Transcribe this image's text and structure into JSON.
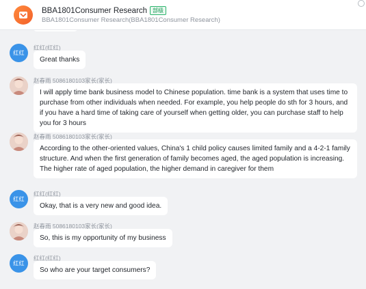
{
  "header": {
    "title": "BBA1801Consumer Research",
    "badge": "部级",
    "subtitle": "BBA1801Consumer Research(BBA1801Consumer Research)"
  },
  "colors": {
    "avatar_blue": "#3a93e8",
    "group_orange": "#f3612a",
    "badge_green": "#29b36b"
  },
  "messages": [
    {
      "sender": "红红(红红)",
      "avatar_text": "红红",
      "text": "Great thanks"
    },
    {
      "sender": "赵春雨 5086180103家长(家长)",
      "text": "I will apply time bank business model to Chinese population. time bank is a system that uses time to purchase from other individuals when needed. For example, you help people do sth for 3 hours, and if you have a hard time of taking care of yourself when getting older, you can purchase staff to help you for 3 hours"
    },
    {
      "sender": "赵春雨 5086180103家长(家长)",
      "text": "According to the other-oriented values, China's 1 child policy causes limited family and a 4-2-1 family structure. And when the first generation of family becomes aged, the aged population is increasing. The higher rate of aged population, the higher demand in caregiver for them"
    },
    {
      "sender": "红红(红红)",
      "avatar_text": "红红",
      "text": "Okay, that is a very new and good idea."
    },
    {
      "sender": "赵春雨 5086180103家长(家长)",
      "text": "So, this is my opportunity of my business"
    },
    {
      "sender": "红红(红红)",
      "avatar_text": "红红",
      "text": "So who are your target consumers?"
    }
  ]
}
